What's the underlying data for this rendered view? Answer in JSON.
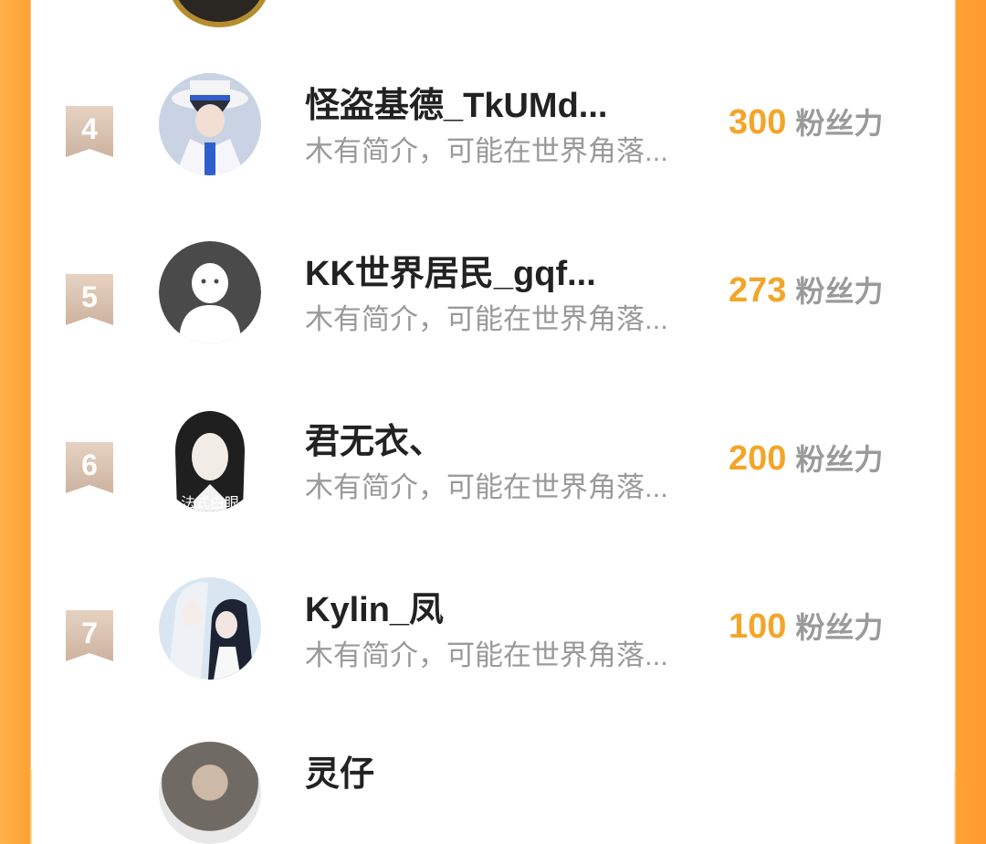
{
  "entries": [
    {
      "rank": "4",
      "name": "怪盗基德_TkUMd...",
      "bio": "木有简介，可能在世界角落...",
      "fans": "300",
      "unit": "粉丝力"
    },
    {
      "rank": "5",
      "name": "KK世界居民_gqf...",
      "bio": "木有简介，可能在世界角落...",
      "fans": "273",
      "unit": "粉丝力"
    },
    {
      "rank": "6",
      "name": "君无衣、",
      "bio": "木有简介，可能在世界角落...",
      "fans": "200",
      "unit": "粉丝力"
    },
    {
      "rank": "7",
      "name": "Kylin_凤",
      "bio": "木有简介，可能在世界角落...",
      "fans": "100",
      "unit": "粉丝力"
    }
  ],
  "partial_next": {
    "name": "灵仔"
  },
  "avatar_text": {
    "entry6": "法式白眼"
  },
  "colors": {
    "accent": "#f3a52a",
    "side": "#ffa234",
    "rank_badge": "#d8bfae"
  }
}
